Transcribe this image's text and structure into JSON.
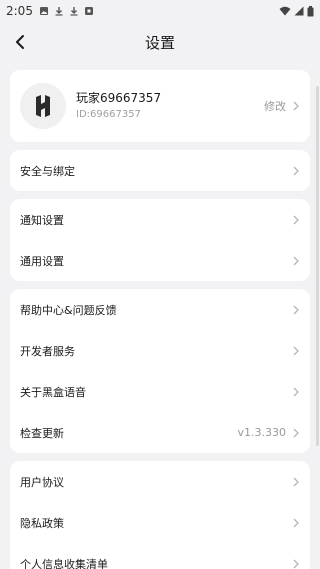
{
  "status_bar": {
    "time": "2:05",
    "left_icons": [
      "image-icon",
      "download-icon",
      "download-icon",
      "app-icon"
    ],
    "right_icons": [
      "wifi-icon",
      "signal-icon",
      "battery-icon"
    ]
  },
  "nav": {
    "title": "设置"
  },
  "profile": {
    "name": "玩家69667357",
    "id_text": "ID:69667357",
    "edit_label": "修改"
  },
  "groups": {
    "security": [
      {
        "label": "安全与绑定"
      }
    ],
    "settings": [
      {
        "label": "通知设置"
      },
      {
        "label": "通用设置"
      }
    ],
    "about": [
      {
        "label": "帮助中心&问题反馈"
      },
      {
        "label": "开发者服务"
      },
      {
        "label": "关于黑盒语音"
      },
      {
        "label": "检查更新",
        "value": "v1.3.330"
      }
    ],
    "legal": [
      {
        "label": "用户协议"
      },
      {
        "label": "隐私政策"
      },
      {
        "label": "个人信息收集清单"
      }
    ]
  },
  "colors": {
    "background": "#f2f2f4",
    "card": "#ffffff",
    "text_primary": "#1a1a1a",
    "text_secondary": "#9a9a9a"
  }
}
